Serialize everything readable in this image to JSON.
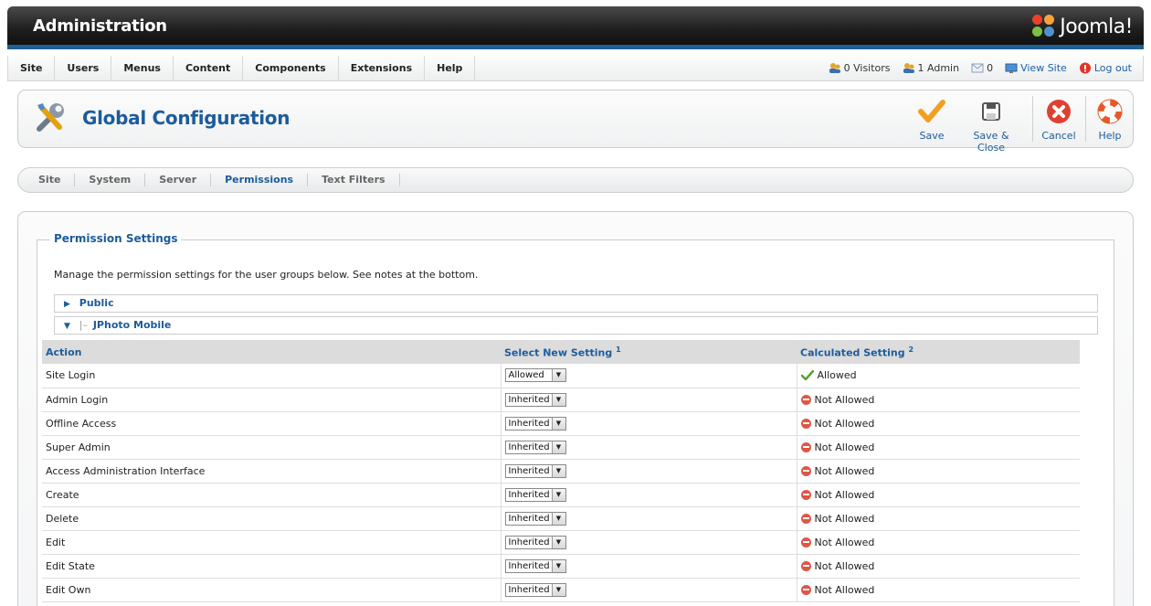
{
  "header": {
    "title": "Administration",
    "brand": "Joomla!"
  },
  "menu": {
    "items": [
      "Site",
      "Users",
      "Menus",
      "Content",
      "Components",
      "Extensions",
      "Help"
    ]
  },
  "status": {
    "visitors": "0 Visitors",
    "admins": "1 Admin",
    "messages": "0",
    "view_site": "View Site",
    "logout": "Log out"
  },
  "toolbar": {
    "title": "Global Configuration",
    "save": "Save",
    "save_close": "Save & Close",
    "cancel": "Cancel",
    "help": "Help"
  },
  "subtabs": [
    "Site",
    "System",
    "Server",
    "Permissions",
    "Text Filters"
  ],
  "active_subtab": "Permissions",
  "permissions": {
    "legend": "Permission Settings",
    "description": "Manage the permission settings for the user groups below. See notes at the bottom.",
    "groups": [
      {
        "name": "Public",
        "prefix": ""
      },
      {
        "name": "JPhoto Mobile",
        "prefix": "|–"
      }
    ],
    "columns": {
      "action": "Action",
      "select": "Select New Setting",
      "select_note": "1",
      "calculated": "Calculated Setting",
      "calculated_note": "2"
    },
    "rows": [
      {
        "action": "Site Login",
        "setting": "Allowed",
        "calculated": "Allowed",
        "state": "allowed"
      },
      {
        "action": "Admin Login",
        "setting": "Inherited",
        "calculated": "Not Allowed",
        "state": "denied"
      },
      {
        "action": "Offline Access",
        "setting": "Inherited",
        "calculated": "Not Allowed",
        "state": "denied"
      },
      {
        "action": "Super Admin",
        "setting": "Inherited",
        "calculated": "Not Allowed",
        "state": "denied"
      },
      {
        "action": "Access Administration Interface",
        "setting": "Inherited",
        "calculated": "Not Allowed",
        "state": "denied"
      },
      {
        "action": "Create",
        "setting": "Inherited",
        "calculated": "Not Allowed",
        "state": "denied"
      },
      {
        "action": "Delete",
        "setting": "Inherited",
        "calculated": "Not Allowed",
        "state": "denied"
      },
      {
        "action": "Edit",
        "setting": "Inherited",
        "calculated": "Not Allowed",
        "state": "denied"
      },
      {
        "action": "Edit State",
        "setting": "Inherited",
        "calculated": "Not Allowed",
        "state": "denied"
      },
      {
        "action": "Edit Own",
        "setting": "Inherited",
        "calculated": "Not Allowed",
        "state": "denied"
      }
    ]
  },
  "colors": {
    "accent": "#1c5c9c",
    "header_bar": "#1f5f92",
    "allowed": "#5aa22c",
    "denied": "#e05545",
    "save": "#f0a020",
    "cancel": "#e04030"
  }
}
